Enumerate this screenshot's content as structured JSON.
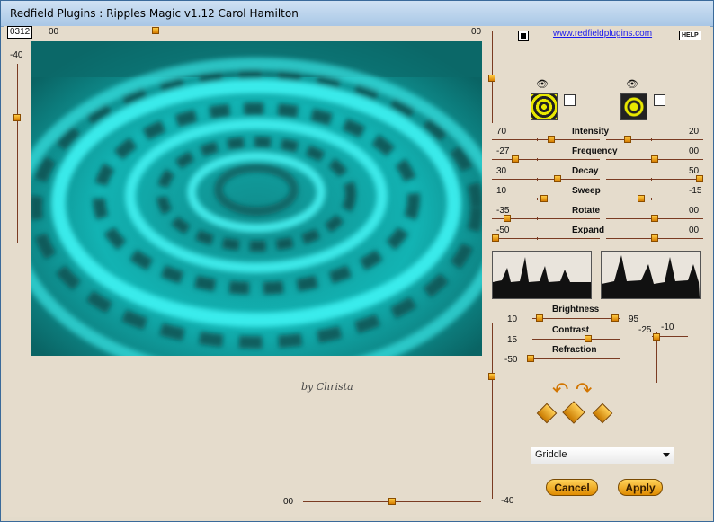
{
  "window": {
    "title": "Redfield Plugins : Ripples Magic v1.12   Carol Hamilton"
  },
  "seed": {
    "value": "0312"
  },
  "top_slider": {
    "left_value": "00",
    "right_value": "00",
    "position": 0.5
  },
  "left_slider": {
    "value": "-40",
    "position": 0.2
  },
  "bottom_slider": {
    "value": "00",
    "position": 0.5
  },
  "right_vslider": {
    "value": "-40",
    "position": 0.12
  },
  "link": {
    "text": "www.redfieldplugins.com"
  },
  "help": {
    "label": "HELP"
  },
  "eye_icon": "eye-icon",
  "params": [
    {
      "label": "Intensity",
      "left": "70",
      "right": "20",
      "left_pos": 0.55,
      "right_pos": 0.2
    },
    {
      "label": "Frequency",
      "left": "-27",
      "right": "00",
      "left_pos": 0.2,
      "right_pos": 0.5
    },
    {
      "label": "Decay",
      "left": "30",
      "right": "50",
      "left_pos": 0.62,
      "right_pos": 1.0
    },
    {
      "label": "Sweep",
      "left": "10",
      "right": "-15",
      "left_pos": 0.48,
      "right_pos": 0.35
    },
    {
      "label": "Rotate",
      "left": "-35",
      "right": "00",
      "left_pos": 0.12,
      "right_pos": 0.5
    },
    {
      "label": "Expand",
      "left": "-50",
      "right": "00",
      "left_pos": 0.0,
      "right_pos": 0.5
    }
  ],
  "brightness": {
    "label": "Brightness",
    "min": "10",
    "max": "95",
    "min_pos": 0.08,
    "max_pos": 0.95
  },
  "contrast": {
    "label": "Contrast",
    "value": "15",
    "pos": 0.55
  },
  "refraction": {
    "label": "Refraction",
    "value": "-50",
    "pos": 0.0
  },
  "small_slider": {
    "top_value": "-10",
    "left_value": "-25"
  },
  "preset": {
    "selected": "Griddle"
  },
  "buttons": {
    "cancel": "Cancel",
    "apply": "Apply"
  },
  "watermark": {
    "text": "by Christa"
  },
  "colors": {
    "accent": "#e08c00",
    "water": "#17c8c8",
    "water_dark": "#0a5a5a"
  }
}
